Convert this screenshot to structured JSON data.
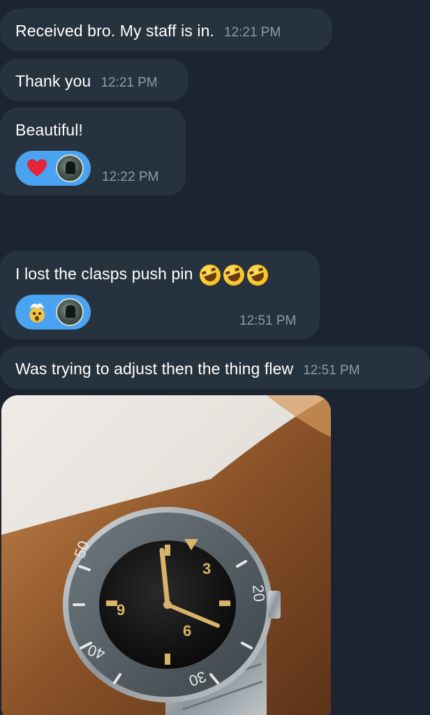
{
  "messages": [
    {
      "text": "Received bro. My staff is in.",
      "time": "12:21 PM"
    },
    {
      "text": "Thank you",
      "time": "12:21 PM"
    },
    {
      "text": "Beautiful!",
      "time": "12:22 PM",
      "reactions": [
        "red-heart-emoji",
        "avatar"
      ]
    },
    {
      "text": "I lost the clasps push pin",
      "time": "12:51 PM",
      "emojis": [
        "rolling-on-floor-laughing-emoji",
        "rolling-on-floor-laughing-emoji",
        "rolling-on-floor-laughing-emoji"
      ],
      "reactions": [
        "exploding-head-emoji",
        "avatar"
      ]
    },
    {
      "text": "Was trying to adjust then the thing flew",
      "time": "12:51 PM"
    }
  ],
  "photo": {
    "description_icon": "watch-photo",
    "bezel_numbers": [
      "50",
      "40",
      "30",
      "20"
    ]
  },
  "colors": {
    "background": "#1b2430",
    "bubble": "#27323f",
    "reaction": "#4aa3f0",
    "timestamp": "#8e9aa8"
  }
}
